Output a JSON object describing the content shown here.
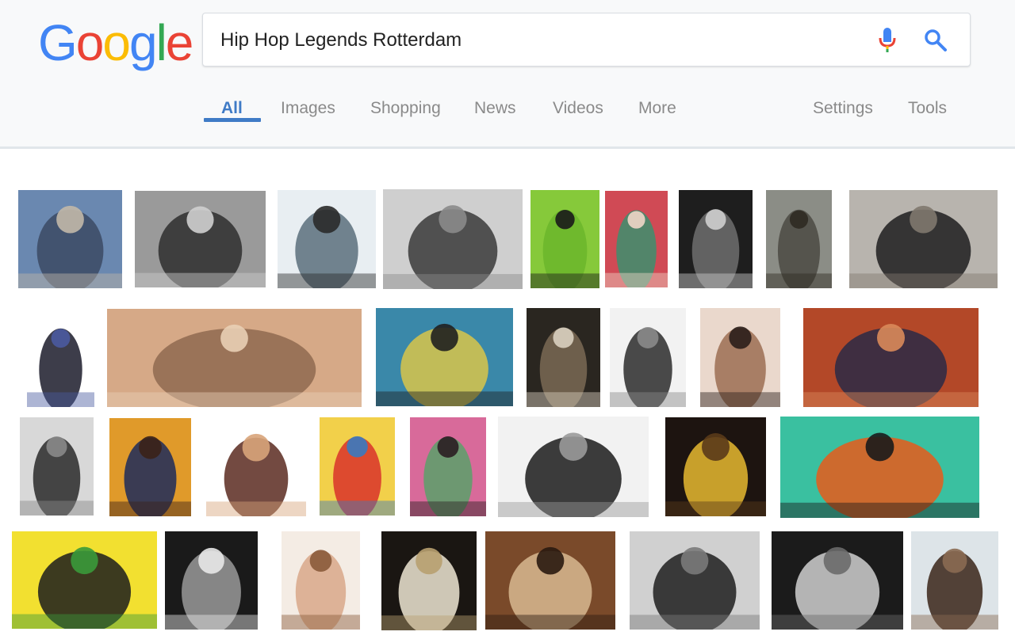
{
  "search": {
    "query": "Hip Hop Legends Rotterdam",
    "logo_text": "Google",
    "logo_colors": [
      "#4285f4",
      "#ea4335",
      "#fbbc05",
      "#4285f4",
      "#34a853",
      "#ea4335"
    ]
  },
  "tabs": {
    "all": "All",
    "images": "Images",
    "shopping": "Shopping",
    "news": "News",
    "videos": "Videos",
    "more": "More",
    "settings": "Settings",
    "tools": "Tools"
  },
  "colors": {
    "accent_blue": "#3f7bc6",
    "tab_gray": "#8a8a8a",
    "header_bg": "#f8f9fa"
  },
  "image_results": {
    "row1": [
      {
        "name": "crew-fisheye-photo",
        "colors": [
          "#6a88b0",
          "#3b4a64",
          "#c2b8a8"
        ]
      },
      {
        "name": "man-with-sunglasses-bw",
        "colors": [
          "#9a9a9a",
          "#2e2e2e",
          "#cfcfcf"
        ]
      },
      {
        "name": "group-in-front-of-train",
        "colors": [
          "#e8eef2",
          "#5a6e7c",
          "#2a2a2a"
        ]
      },
      {
        "name": "men-in-coats-bw",
        "colors": [
          "#cfcfcf",
          "#3a3a3a",
          "#8a8a8a"
        ]
      },
      {
        "name": "green-concert-poster",
        "colors": [
          "#86c93a",
          "#6bb62c",
          "#1a1a1a"
        ]
      },
      {
        "name": "man-colorful-suit",
        "colors": [
          "#d04a55",
          "#3c8f6e",
          "#efd6c8"
        ]
      },
      {
        "name": "man-white-tshirt-bw",
        "colors": [
          "#1e1e1e",
          "#6e6e6e",
          "#cfcfcf"
        ]
      },
      {
        "name": "man-on-stairs",
        "colors": [
          "#8b8d86",
          "#4b4a43",
          "#2f2a22"
        ]
      },
      {
        "name": "duo-back-to-back",
        "colors": [
          "#b8b4ae",
          "#1d1d1f",
          "#80786e"
        ]
      }
    ],
    "row2": [
      {
        "name": "graffiti-scribble-art",
        "colors": [
          "#ffffff",
          "#1b1b2a",
          "#4a5aa0"
        ]
      },
      {
        "name": "newspaper-clipping",
        "colors": [
          "#d6a987",
          "#8f6a50",
          "#e9cfb5"
        ]
      },
      {
        "name": "graffiti-train-with-car",
        "colors": [
          "#3a88a9",
          "#d9c64a",
          "#202020"
        ]
      },
      {
        "name": "magazine-group-page",
        "colors": [
          "#2a2620",
          "#7a6a55",
          "#d9d0c0"
        ]
      },
      {
        "name": "magazine-spread-bw",
        "colors": [
          "#f2f2f2",
          "#2b2b2b",
          "#8a8a8a"
        ]
      },
      {
        "name": "shirtless-group",
        "colors": [
          "#ead8cc",
          "#9c6e52",
          "#2a1e1a"
        ]
      },
      {
        "name": "crew-portrait-color",
        "colors": [
          "#b34828",
          "#2a2a45",
          "#d98a5a"
        ]
      }
    ],
    "row3": [
      {
        "name": "man-at-turntables-bw",
        "colors": [
          "#d8d8d8",
          "#2a2a2a",
          "#8a8a8a"
        ]
      },
      {
        "name": "snoop-portrait",
        "colors": [
          "#e09a2a",
          "#1c2a5a",
          "#3b2218"
        ]
      },
      {
        "name": "woman-with-headpiece",
        "colors": [
          "#ffffff",
          "#5a2a20",
          "#d8a47a"
        ]
      },
      {
        "name": "comic-book-cover",
        "colors": [
          "#f2d04a",
          "#d9332a",
          "#3a7ac0"
        ]
      },
      {
        "name": "floral-portrait",
        "colors": [
          "#d86a9a",
          "#5aa06a",
          "#2a1e22"
        ]
      },
      {
        "name": "life-is-fresh-mural",
        "colors": [
          "#f2f2f2",
          "#1b1b1b",
          "#9a9a9a"
        ]
      },
      {
        "name": "enter-the-wu-tang-cover",
        "colors": [
          "#1d1410",
          "#e6b830",
          "#5a3a1a"
        ]
      },
      {
        "name": "graffiti-wall",
        "colors": [
          "#3ac0a0",
          "#e85a1a",
          "#1b1b1b"
        ]
      }
    ],
    "row4": [
      {
        "name": "de-la-soul-cover",
        "colors": [
          "#f2e030",
          "#1c1c1c",
          "#3a9a3a"
        ]
      },
      {
        "name": "tupac-portrait-bw",
        "colors": [
          "#1a1a1a",
          "#9a9a9a",
          "#e8e8e8"
        ]
      },
      {
        "name": "woman-tattoos-photo",
        "colors": [
          "#f4ece4",
          "#d8a88a",
          "#8a5a3a"
        ]
      },
      {
        "name": "basquiat-artwork",
        "colors": [
          "#1a1612",
          "#efe6d4",
          "#b8a070"
        ]
      },
      {
        "name": "smiling-man-closeup",
        "colors": [
          "#7a4a2a",
          "#d8b890",
          "#2a1a10"
        ]
      },
      {
        "name": "hallway-duo-bw",
        "colors": [
          "#d0d0d0",
          "#1e1e1e",
          "#7a7a7a"
        ]
      },
      {
        "name": "performers-on-stage-bw",
        "colors": [
          "#1b1b1b",
          "#cfcfcf",
          "#6a6a6a"
        ]
      },
      {
        "name": "man-with-hat-portrait",
        "colors": [
          "#dde4e8",
          "#3a2418",
          "#8a6a52"
        ]
      }
    ]
  }
}
